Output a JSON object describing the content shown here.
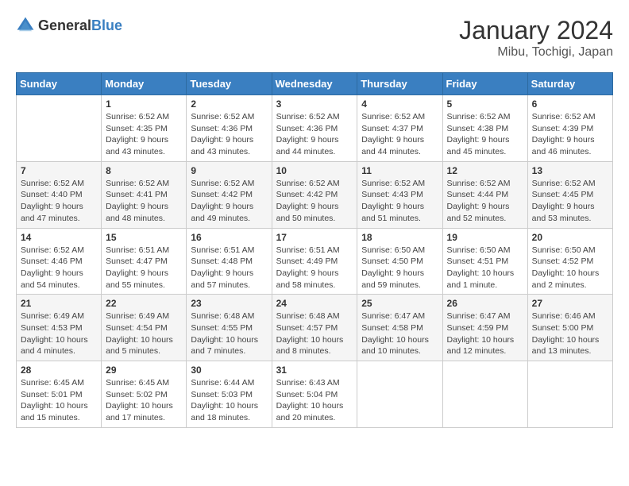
{
  "logo": {
    "general": "General",
    "blue": "Blue"
  },
  "title": "January 2024",
  "subtitle": "Mibu, Tochigi, Japan",
  "days_header": [
    "Sunday",
    "Monday",
    "Tuesday",
    "Wednesday",
    "Thursday",
    "Friday",
    "Saturday"
  ],
  "weeks": [
    [
      {
        "day": "",
        "sunrise": "",
        "sunset": "",
        "daylight": ""
      },
      {
        "day": "1",
        "sunrise": "Sunrise: 6:52 AM",
        "sunset": "Sunset: 4:35 PM",
        "daylight": "Daylight: 9 hours and 43 minutes."
      },
      {
        "day": "2",
        "sunrise": "Sunrise: 6:52 AM",
        "sunset": "Sunset: 4:36 PM",
        "daylight": "Daylight: 9 hours and 43 minutes."
      },
      {
        "day": "3",
        "sunrise": "Sunrise: 6:52 AM",
        "sunset": "Sunset: 4:36 PM",
        "daylight": "Daylight: 9 hours and 44 minutes."
      },
      {
        "day": "4",
        "sunrise": "Sunrise: 6:52 AM",
        "sunset": "Sunset: 4:37 PM",
        "daylight": "Daylight: 9 hours and 44 minutes."
      },
      {
        "day": "5",
        "sunrise": "Sunrise: 6:52 AM",
        "sunset": "Sunset: 4:38 PM",
        "daylight": "Daylight: 9 hours and 45 minutes."
      },
      {
        "day": "6",
        "sunrise": "Sunrise: 6:52 AM",
        "sunset": "Sunset: 4:39 PM",
        "daylight": "Daylight: 9 hours and 46 minutes."
      }
    ],
    [
      {
        "day": "7",
        "sunrise": "Sunrise: 6:52 AM",
        "sunset": "Sunset: 4:40 PM",
        "daylight": "Daylight: 9 hours and 47 minutes."
      },
      {
        "day": "8",
        "sunrise": "Sunrise: 6:52 AM",
        "sunset": "Sunset: 4:41 PM",
        "daylight": "Daylight: 9 hours and 48 minutes."
      },
      {
        "day": "9",
        "sunrise": "Sunrise: 6:52 AM",
        "sunset": "Sunset: 4:42 PM",
        "daylight": "Daylight: 9 hours and 49 minutes."
      },
      {
        "day": "10",
        "sunrise": "Sunrise: 6:52 AM",
        "sunset": "Sunset: 4:42 PM",
        "daylight": "Daylight: 9 hours and 50 minutes."
      },
      {
        "day": "11",
        "sunrise": "Sunrise: 6:52 AM",
        "sunset": "Sunset: 4:43 PM",
        "daylight": "Daylight: 9 hours and 51 minutes."
      },
      {
        "day": "12",
        "sunrise": "Sunrise: 6:52 AM",
        "sunset": "Sunset: 4:44 PM",
        "daylight": "Daylight: 9 hours and 52 minutes."
      },
      {
        "day": "13",
        "sunrise": "Sunrise: 6:52 AM",
        "sunset": "Sunset: 4:45 PM",
        "daylight": "Daylight: 9 hours and 53 minutes."
      }
    ],
    [
      {
        "day": "14",
        "sunrise": "Sunrise: 6:52 AM",
        "sunset": "Sunset: 4:46 PM",
        "daylight": "Daylight: 9 hours and 54 minutes."
      },
      {
        "day": "15",
        "sunrise": "Sunrise: 6:51 AM",
        "sunset": "Sunset: 4:47 PM",
        "daylight": "Daylight: 9 hours and 55 minutes."
      },
      {
        "day": "16",
        "sunrise": "Sunrise: 6:51 AM",
        "sunset": "Sunset: 4:48 PM",
        "daylight": "Daylight: 9 hours and 57 minutes."
      },
      {
        "day": "17",
        "sunrise": "Sunrise: 6:51 AM",
        "sunset": "Sunset: 4:49 PM",
        "daylight": "Daylight: 9 hours and 58 minutes."
      },
      {
        "day": "18",
        "sunrise": "Sunrise: 6:50 AM",
        "sunset": "Sunset: 4:50 PM",
        "daylight": "Daylight: 9 hours and 59 minutes."
      },
      {
        "day": "19",
        "sunrise": "Sunrise: 6:50 AM",
        "sunset": "Sunset: 4:51 PM",
        "daylight": "Daylight: 10 hours and 1 minute."
      },
      {
        "day": "20",
        "sunrise": "Sunrise: 6:50 AM",
        "sunset": "Sunset: 4:52 PM",
        "daylight": "Daylight: 10 hours and 2 minutes."
      }
    ],
    [
      {
        "day": "21",
        "sunrise": "Sunrise: 6:49 AM",
        "sunset": "Sunset: 4:53 PM",
        "daylight": "Daylight: 10 hours and 4 minutes."
      },
      {
        "day": "22",
        "sunrise": "Sunrise: 6:49 AM",
        "sunset": "Sunset: 4:54 PM",
        "daylight": "Daylight: 10 hours and 5 minutes."
      },
      {
        "day": "23",
        "sunrise": "Sunrise: 6:48 AM",
        "sunset": "Sunset: 4:55 PM",
        "daylight": "Daylight: 10 hours and 7 minutes."
      },
      {
        "day": "24",
        "sunrise": "Sunrise: 6:48 AM",
        "sunset": "Sunset: 4:57 PM",
        "daylight": "Daylight: 10 hours and 8 minutes."
      },
      {
        "day": "25",
        "sunrise": "Sunrise: 6:47 AM",
        "sunset": "Sunset: 4:58 PM",
        "daylight": "Daylight: 10 hours and 10 minutes."
      },
      {
        "day": "26",
        "sunrise": "Sunrise: 6:47 AM",
        "sunset": "Sunset: 4:59 PM",
        "daylight": "Daylight: 10 hours and 12 minutes."
      },
      {
        "day": "27",
        "sunrise": "Sunrise: 6:46 AM",
        "sunset": "Sunset: 5:00 PM",
        "daylight": "Daylight: 10 hours and 13 minutes."
      }
    ],
    [
      {
        "day": "28",
        "sunrise": "Sunrise: 6:45 AM",
        "sunset": "Sunset: 5:01 PM",
        "daylight": "Daylight: 10 hours and 15 minutes."
      },
      {
        "day": "29",
        "sunrise": "Sunrise: 6:45 AM",
        "sunset": "Sunset: 5:02 PM",
        "daylight": "Daylight: 10 hours and 17 minutes."
      },
      {
        "day": "30",
        "sunrise": "Sunrise: 6:44 AM",
        "sunset": "Sunset: 5:03 PM",
        "daylight": "Daylight: 10 hours and 18 minutes."
      },
      {
        "day": "31",
        "sunrise": "Sunrise: 6:43 AM",
        "sunset": "Sunset: 5:04 PM",
        "daylight": "Daylight: 10 hours and 20 minutes."
      },
      {
        "day": "",
        "sunrise": "",
        "sunset": "",
        "daylight": ""
      },
      {
        "day": "",
        "sunrise": "",
        "sunset": "",
        "daylight": ""
      },
      {
        "day": "",
        "sunrise": "",
        "sunset": "",
        "daylight": ""
      }
    ]
  ]
}
